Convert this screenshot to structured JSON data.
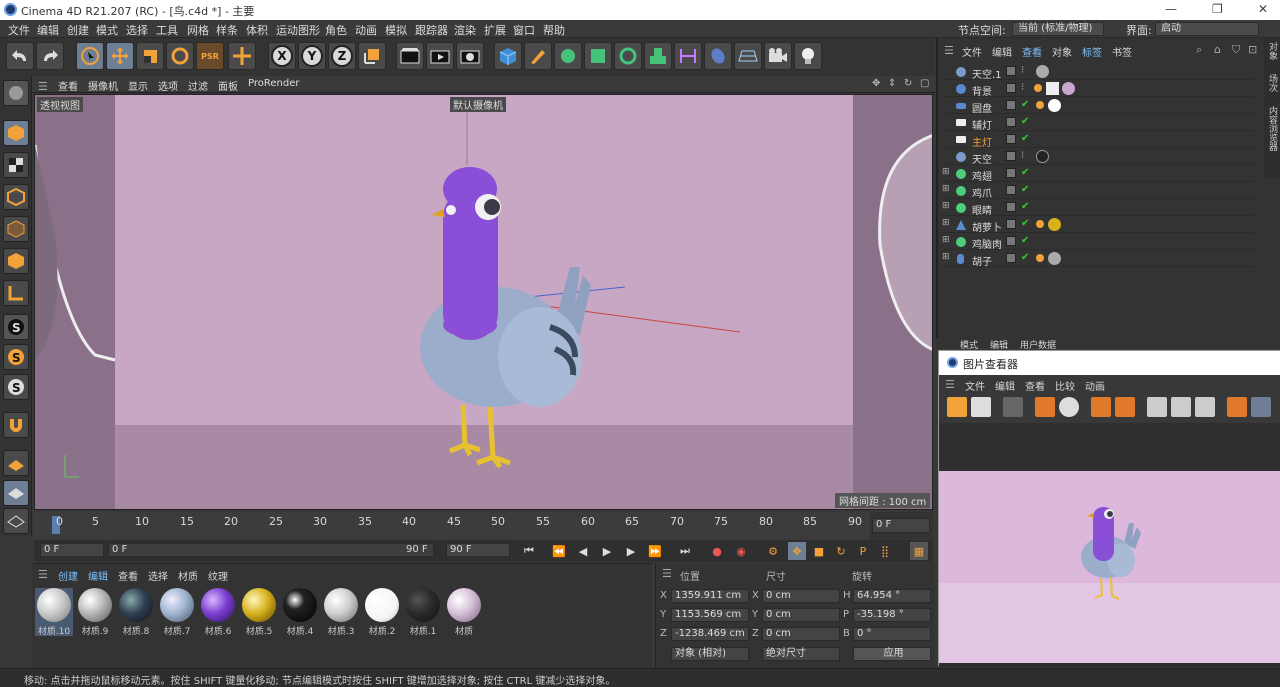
{
  "window": {
    "title": "Cinema 4D R21.207 (RC) - [鸟.c4d *] - 主要",
    "min": "—",
    "max": "❐",
    "close": "✕"
  },
  "menubar": {
    "items": [
      "文件",
      "编辑",
      "创建",
      "模式",
      "选择",
      "工具",
      "网格",
      "样条",
      "体积",
      "运动图形",
      "角色",
      "动画",
      "模拟",
      "跟踪器",
      "渲染",
      "扩展",
      "窗口",
      "帮助"
    ],
    "node_space_label": "节点空间:",
    "node_space_value": "当前 (标准/物理)",
    "layout_label": "界面:",
    "layout_value": "启动"
  },
  "viewport": {
    "menu": [
      "查看",
      "摄像机",
      "显示",
      "选项",
      "过滤",
      "面板",
      "ProRender"
    ],
    "view_name": "透视视图",
    "camera_name": "默认摄像机",
    "grid_text": "网格间距 : 100 cm"
  },
  "timeline": {
    "ticks": [
      "0",
      "5",
      "10",
      "15",
      "20",
      "25",
      "30",
      "35",
      "40",
      "45",
      "50",
      "55",
      "60",
      "65",
      "70",
      "75",
      "80",
      "85",
      "90"
    ],
    "current_frame": "0 F"
  },
  "playback": {
    "start": "0 F",
    "range_start": "0 F",
    "range_end": "90 F",
    "end": "90 F"
  },
  "materials": {
    "menu": [
      "创建",
      "编辑",
      "查看",
      "选择",
      "材质",
      "纹理"
    ],
    "items": [
      {
        "label": "材质.10",
        "color": "#c9c9c9"
      },
      {
        "label": "材质.9",
        "color": "#d0d0d0"
      },
      {
        "label": "材质.8",
        "color": "#2f3f55"
      },
      {
        "label": "材质.7",
        "color": "#9fb4cf"
      },
      {
        "label": "材质.6",
        "color": "#7b3fd0"
      },
      {
        "label": "材质.5",
        "color": "#d8b21c"
      },
      {
        "label": "材质.4",
        "color": "#222222"
      },
      {
        "label": "材质.3",
        "color": "#cfcfcf"
      },
      {
        "label": "材质.2",
        "color": "#f5f5f5"
      },
      {
        "label": "材质.1",
        "color": "#2a2a2a"
      },
      {
        "label": "材质",
        "color": "#d5bfd8"
      }
    ]
  },
  "coords": {
    "headers": [
      "位置",
      "尺寸",
      "旋转"
    ],
    "rows": [
      {
        "axis": "X",
        "pos": "1359.911 cm",
        "size_axis": "X",
        "size": "0 cm",
        "rot_axis": "H",
        "rot": "64.954 °"
      },
      {
        "axis": "Y",
        "pos": "1153.569 cm",
        "size_axis": "Y",
        "size": "0 cm",
        "rot_axis": "P",
        "rot": "-35.198 °"
      },
      {
        "axis": "Z",
        "pos": "-1238.469 cm",
        "size_axis": "Z",
        "size": "0 cm",
        "rot_axis": "B",
        "rot": "0 °"
      }
    ],
    "mode": "对象 (相对)",
    "size_mode": "绝对尺寸",
    "apply": "应用"
  },
  "objects": {
    "menu": [
      "文件",
      "编辑",
      "查看",
      "对象",
      "标签",
      "书签"
    ],
    "rows": [
      {
        "name": "天空.1",
        "color": "#7a9cc8"
      },
      {
        "name": "背景",
        "color": "#5a8ad0"
      },
      {
        "name": "圆盘",
        "color": "#5a8ad0"
      },
      {
        "name": "辅灯",
        "color": "#eeeeee"
      },
      {
        "name": "主灯",
        "color": "#eeeeee",
        "active": true
      },
      {
        "name": "天空",
        "color": "#7a9cc8"
      },
      {
        "name": "鸡翅",
        "color": "#4ccf7a"
      },
      {
        "name": "鸡爪",
        "color": "#4ccf7a"
      },
      {
        "name": "眼睛",
        "color": "#4ccf7a"
      },
      {
        "name": "胡萝卜",
        "color": "#5a8ad0"
      },
      {
        "name": "鸡脑肉",
        "color": "#4ccf7a"
      },
      {
        "name": "胡子",
        "color": "#5a8ad0"
      }
    ]
  },
  "attr": {
    "menu": [
      "模式",
      "编辑",
      "用户数据"
    ]
  },
  "picture_viewer": {
    "title": "图片查看器",
    "menu": [
      "文件",
      "编辑",
      "查看",
      "比较",
      "动画"
    ]
  },
  "right_tabs": [
    "对象",
    "场次",
    "内容浏览器"
  ],
  "status": "移动: 点击并拖动鼠标移动元素。按住 SHIFT 键量化移动; 节点编辑模式时按住 SHIFT 键增加选择对象; 按住 CTRL 键减少选择对象。"
}
